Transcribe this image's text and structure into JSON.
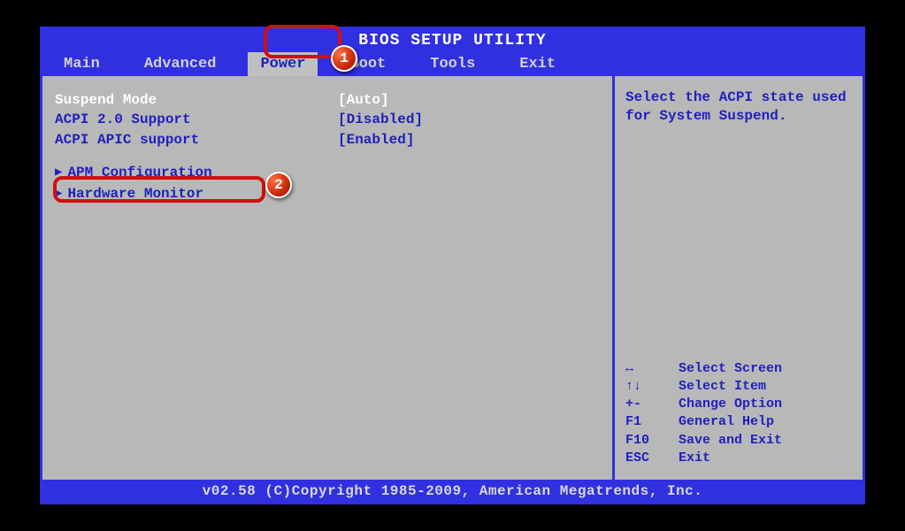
{
  "title": "BIOS SETUP UTILITY",
  "tabs": [
    {
      "label": "Main",
      "active": false
    },
    {
      "label": "Advanced",
      "active": false
    },
    {
      "label": "Power",
      "active": true
    },
    {
      "label": "Boot",
      "active": false
    },
    {
      "label": "Tools",
      "active": false
    },
    {
      "label": "Exit",
      "active": false
    }
  ],
  "settings": [
    {
      "label": "Suspend Mode",
      "value": "[Auto]",
      "selected": true
    },
    {
      "label": "ACPI 2.0 Support",
      "value": "[Disabled]",
      "selected": false
    },
    {
      "label": "ACPI APIC support",
      "value": "[Enabled]",
      "selected": false
    }
  ],
  "submenus": [
    {
      "label": "APM Configuration"
    },
    {
      "label": "Hardware Monitor"
    }
  ],
  "help_text": "Select the ACPI state used for System Suspend.",
  "shortcuts": [
    {
      "key": "↔",
      "desc": "Select Screen"
    },
    {
      "key": "↑↓",
      "desc": "Select Item"
    },
    {
      "key": "+-",
      "desc": "Change Option"
    },
    {
      "key": "F1",
      "desc": "General Help"
    },
    {
      "key": "F10",
      "desc": "Save and Exit"
    },
    {
      "key": "ESC",
      "desc": "Exit"
    }
  ],
  "footer": "v02.58 (C)Copyright 1985-2009, American Megatrends, Inc.",
  "callouts": {
    "b1": "1",
    "b2": "2"
  },
  "colors": {
    "accent": "#3030e0",
    "highlight": "#d01010",
    "panel": "#b8b8b8"
  }
}
